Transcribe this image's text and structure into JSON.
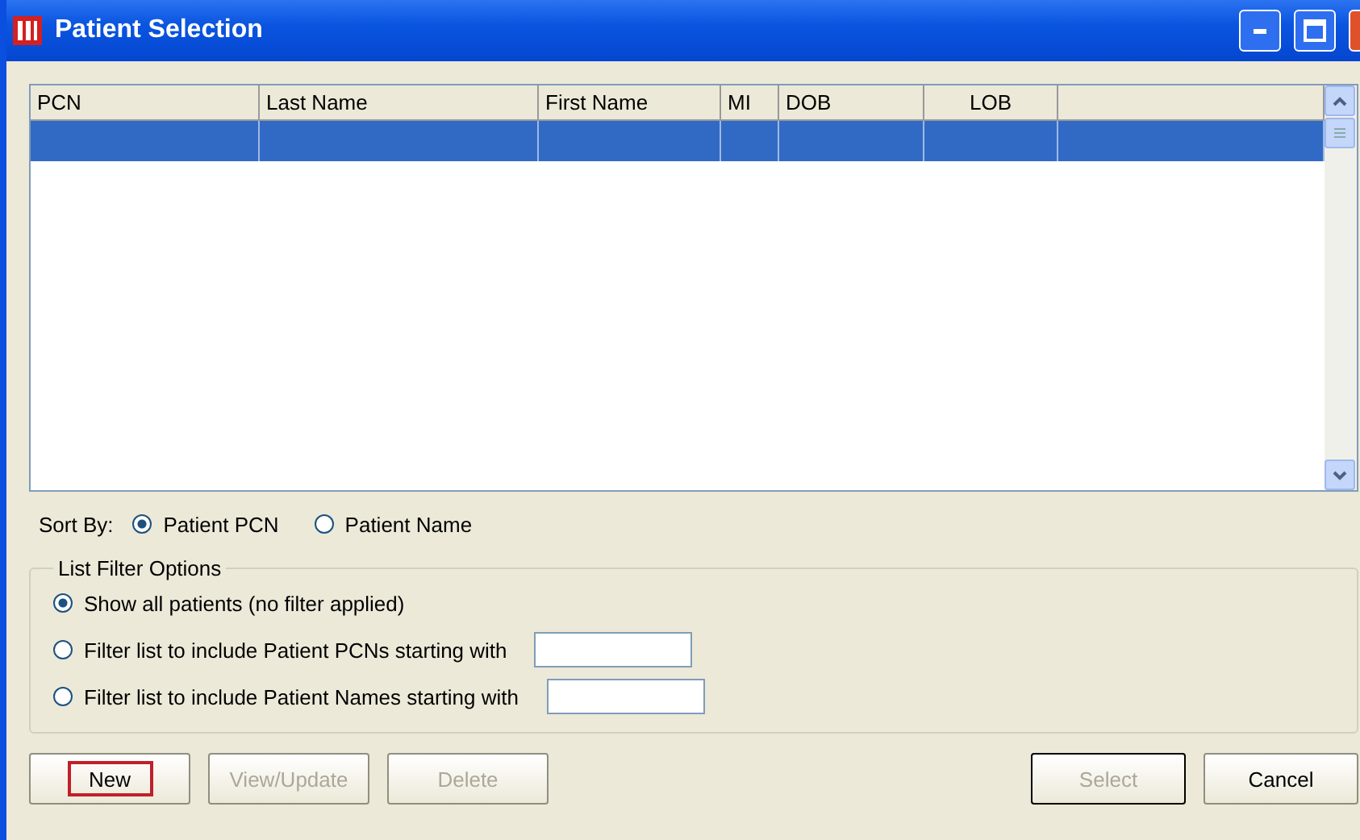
{
  "window": {
    "title": "Patient Selection"
  },
  "table": {
    "columns": [
      "PCN",
      "Last Name",
      "First Name",
      "MI",
      "DOB",
      "LOB"
    ],
    "rows": [
      {
        "selected": true,
        "cells": [
          "",
          "",
          "",
          "",
          "",
          ""
        ]
      }
    ]
  },
  "sort_by": {
    "label": "Sort By:",
    "options": [
      {
        "label": "Patient PCN",
        "selected": true
      },
      {
        "label": "Patient Name",
        "selected": false
      }
    ]
  },
  "filter": {
    "title": "List Filter Options",
    "options": [
      {
        "kind": "plain",
        "label": "Show all patients (no filter applied)",
        "selected": true
      },
      {
        "kind": "field",
        "label": "Filter list to include Patient PCNs starting with",
        "selected": false
      },
      {
        "kind": "field",
        "label": "Filter list to include Patient Names starting with",
        "selected": false
      }
    ]
  },
  "buttons_left": [
    {
      "label": "New",
      "disabled": false,
      "highlighted": true
    },
    {
      "label": "View/Update",
      "disabled": true,
      "highlighted": false
    },
    {
      "label": "Delete",
      "disabled": true,
      "highlighted": false
    }
  ],
  "buttons_right": [
    {
      "label": "Select",
      "disabled": true,
      "default": true
    },
    {
      "label": "Cancel",
      "disabled": false,
      "default": false
    }
  ]
}
